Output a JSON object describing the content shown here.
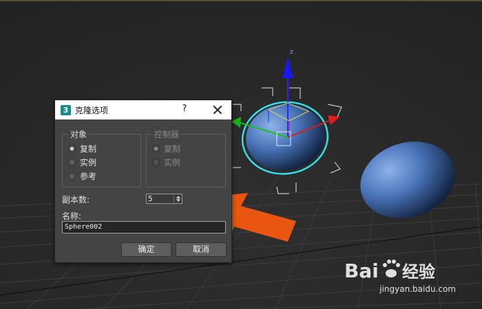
{
  "dialog": {
    "app_icon": "3",
    "title": "克隆选项",
    "help_label": "?",
    "object_group": {
      "title": "对象",
      "options": [
        {
          "label": "复制",
          "checked": true
        },
        {
          "label": "实例",
          "checked": false
        },
        {
          "label": "参考",
          "checked": false
        }
      ]
    },
    "controller_group": {
      "title": "控制器",
      "enabled": false,
      "options": [
        {
          "label": "复制",
          "checked": true
        },
        {
          "label": "实例",
          "checked": false
        }
      ]
    },
    "copies_label": "副本数:",
    "copies_value": "5",
    "name_label": "名称:",
    "name_value": "Sphere002",
    "ok_label": "确定",
    "cancel_label": "取消"
  },
  "viewport": {
    "gizmo_axis_label": "z",
    "selection_color": "#33e0ee",
    "sphere_color": "#3f6ab0",
    "arrow_color": "#e8560f"
  },
  "watermark": {
    "brand": "Bai经验",
    "url": "jingyan.baidu.com"
  }
}
